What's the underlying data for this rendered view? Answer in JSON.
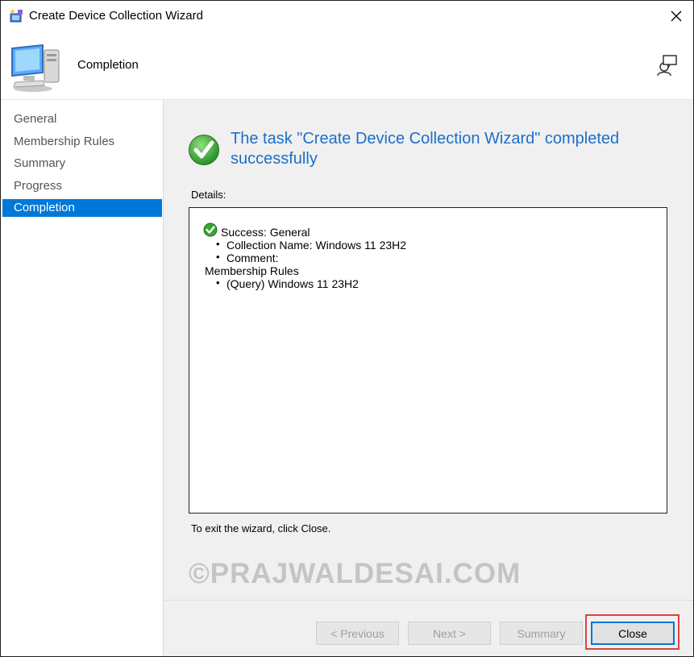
{
  "window": {
    "title": "Create Device Collection Wizard"
  },
  "header": {
    "title": "Completion"
  },
  "sidebar": {
    "items": [
      {
        "label": "General"
      },
      {
        "label": "Membership Rules"
      },
      {
        "label": "Summary"
      },
      {
        "label": "Progress"
      },
      {
        "label": "Completion",
        "selected": true
      }
    ]
  },
  "main": {
    "headline": "The task \"Create Device Collection Wizard\" completed successfully",
    "details_label": "Details:",
    "details": {
      "success_line": "Success: General",
      "collection_name": "Collection Name: Windows 11 23H2",
      "comment": "Comment:",
      "membership_heading": "Membership Rules",
      "membership_rule": "(Query) Windows 11 23H2"
    },
    "exit_hint": "To exit the wizard, click Close.",
    "watermark": "©PRAJWALDESAI.COM"
  },
  "footer": {
    "previous_label": "< Previous",
    "next_label": "Next >",
    "summary_label": "Summary",
    "close_label": "Close"
  },
  "colors": {
    "accent": "#0078d7",
    "headline": "#1c6fc9",
    "success": "#3aa535",
    "highlight_box": "#e04040"
  },
  "icons": [
    "wizard-app-icon",
    "close-icon",
    "computer-icon",
    "help-icon",
    "success-check-icon"
  ]
}
